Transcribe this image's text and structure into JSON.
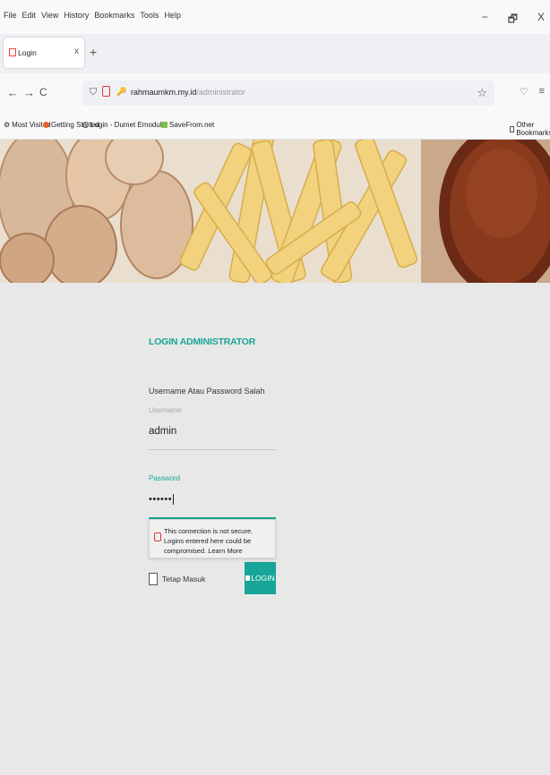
{
  "menubar": {
    "items": [
      "File",
      "Edit",
      "View",
      "History",
      "Bookmarks",
      "Tools",
      "Help"
    ],
    "window_controls": [
      "−",
      "🗗",
      "X"
    ]
  },
  "tab": {
    "title": "Login",
    "close": "x",
    "new_tab": "+"
  },
  "nav": {
    "back": "←",
    "forward": "→",
    "reload": "C",
    "url_host": "rahmaumkm.my.id",
    "url_path": "/administrator",
    "bookmark_star": "☆",
    "pocket": "♡",
    "menu": "≡"
  },
  "bookmarks": {
    "items": [
      "Most Visited",
      "Getting Started",
      "Login - Dumet Emodule",
      "SaveFrom.net"
    ],
    "other": "Other Bookmarks"
  },
  "login": {
    "title": "LOGIN ADMINISTRATOR",
    "error": "Username Atau Password Salah",
    "username_label": "Username",
    "username_value": "admin",
    "password_label": "Password",
    "password_value": "••••••",
    "warning_text": "This connection is not secure. Logins entered here could be compromised.",
    "warning_link": "Learn More",
    "remember_label": "Tetap Masuk",
    "button": "LOGIN"
  },
  "colors": {
    "accent": "#16a596",
    "page_bg": "#e8e8e8",
    "warning_red": "#dd3333"
  }
}
